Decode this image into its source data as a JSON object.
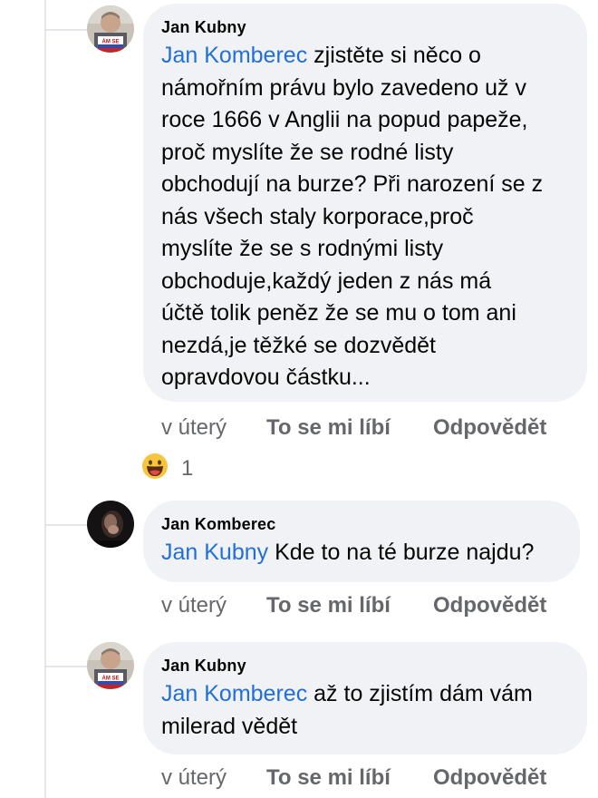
{
  "comments": [
    {
      "author": "Jan Kubny",
      "mention": "Jan Komberec",
      "lines": [
        " zjistěte si něco o",
        "námořním právu bylo zavedeno už v",
        "roce 1666 v Anglii na popud papeže,",
        "proč myslíte že se rodné listy",
        "obchodují na burze? Při narození se z",
        "nás všech staly korporace,proč",
        "myslíte že se s rodnými listy",
        "obchoduje,každý jeden z nás má",
        "účtě tolik peněz že se mu o tom ani",
        "nezdá,je těžké se dozvědět",
        "opravdovou částku..."
      ],
      "time": "v úterý",
      "like": "To se mi líbí",
      "reply": "Odpovědět",
      "reaction_count": "1",
      "reaction_icon": "haha-emoji-icon"
    },
    {
      "author": "Jan Komberec",
      "mention": "Jan Kubny",
      "lines": [
        " Kde to na té burze najdu?"
      ],
      "time": "v úterý",
      "like": "To se mi líbí",
      "reply": "Odpovědět"
    },
    {
      "author": "Jan Kubny",
      "mention": "Jan Komberec",
      "lines": [
        " až to zjistím dám vám",
        "milerad vědět"
      ],
      "time": "v úterý",
      "like": "To se mi líbí",
      "reply": "Odpovědět"
    }
  ],
  "avatar_badge_text": "ÁM SE",
  "colors": {
    "bubble": "#f0f2f5",
    "mention": "#216fdb",
    "meta": "#65676b",
    "text": "#050505",
    "thread_line": "#e4e6eb"
  }
}
